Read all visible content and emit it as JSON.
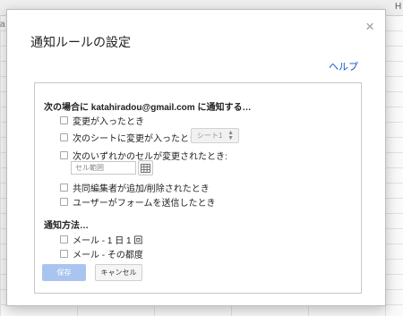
{
  "background": {
    "column_header_label": "H",
    "edge_char": "a"
  },
  "dialog": {
    "title": "通知ルールの設定",
    "close_label": "×",
    "help_label": "ヘルプ"
  },
  "when_section": {
    "heading": "次の場合に katahiradou@gmail.com に通知する…",
    "options": [
      {
        "label": "変更が入ったとき",
        "checked": false
      },
      {
        "label": "次のシートに変更が入ったとき:",
        "checked": false
      },
      {
        "label": "次のいずれかのセルが変更されたとき:",
        "checked": false
      },
      {
        "label": "共同編集者が追加/削除されたとき",
        "checked": false
      },
      {
        "label": "ユーザーがフォームを送信したとき",
        "checked": false
      }
    ],
    "sheet_select_value": "シート1",
    "range_placeholder": "セル範囲"
  },
  "method_section": {
    "heading": "通知方法…",
    "options": [
      {
        "label": "メール - 1 日 1 回",
        "checked": false
      },
      {
        "label": "メール - その都度",
        "checked": false
      }
    ]
  },
  "buttons": {
    "save": "保存",
    "cancel": "キャンセル"
  },
  "colors": {
    "link": "#1155cc",
    "save_disabled": "#a9c5ef"
  }
}
